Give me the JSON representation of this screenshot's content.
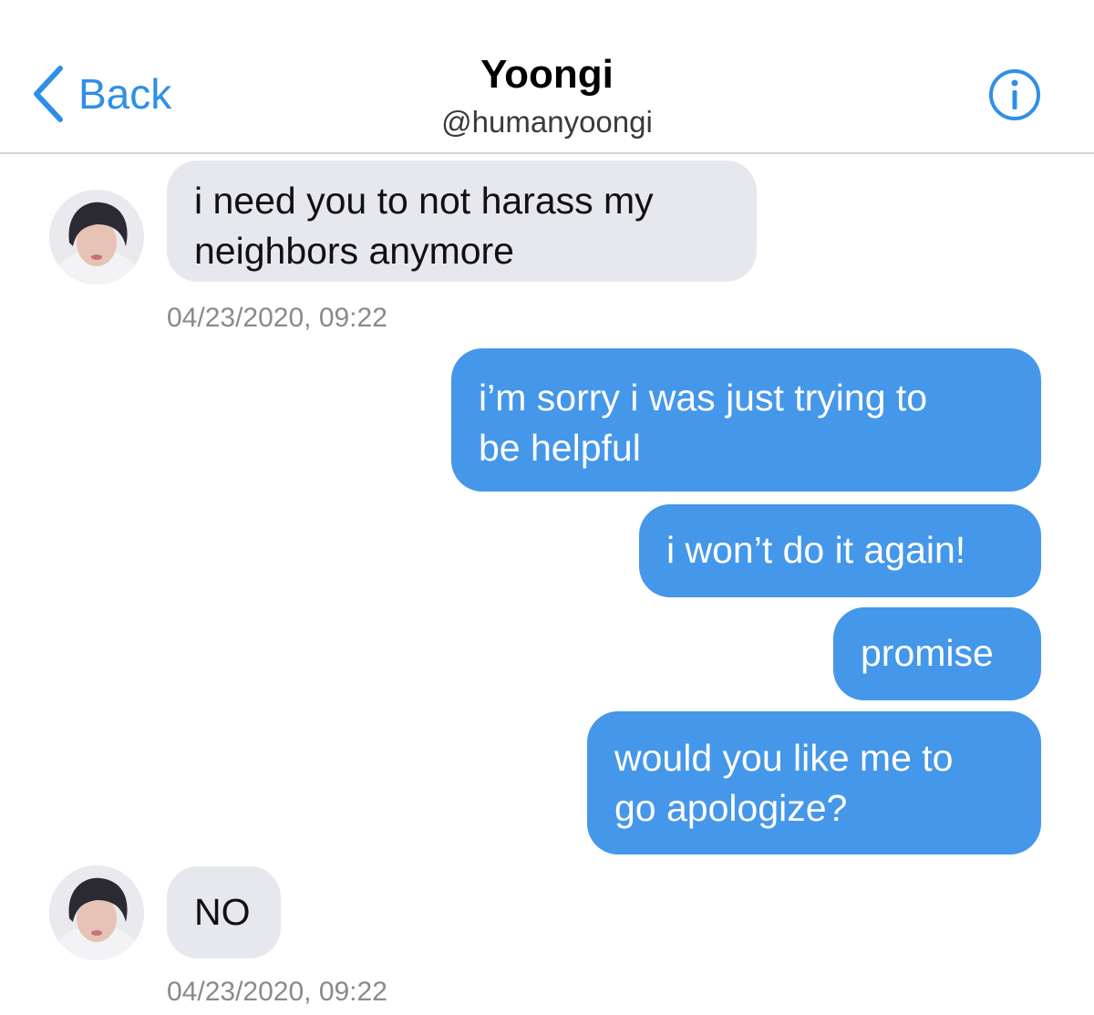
{
  "header": {
    "back_label": "Back",
    "name": "Yoongi",
    "handle": "@humanyoongi",
    "back_icon": "chevron-left-icon",
    "info_icon": "info-icon",
    "accent_color": "#2f8fe8"
  },
  "colors": {
    "incoming_bubble": "#e6e8ed",
    "outgoing_bubble": "#4597ea",
    "timestamp": "#8a8a8e"
  },
  "messages": [
    {
      "direction": "incoming",
      "text": "i need you to not harass my\nneighbors anymore"
    },
    {
      "direction": "outgoing",
      "text": "i’m sorry i was just trying to\nbe helpful"
    },
    {
      "direction": "outgoing",
      "text": "i won’t do it again!"
    },
    {
      "direction": "outgoing",
      "text": "promise"
    },
    {
      "direction": "outgoing",
      "text": "would you like me to\ngo apologize?"
    },
    {
      "direction": "incoming",
      "text": "NO"
    }
  ],
  "timestamps": [
    "04/23/2020, 09:22",
    "04/23/2020, 09:22"
  ]
}
